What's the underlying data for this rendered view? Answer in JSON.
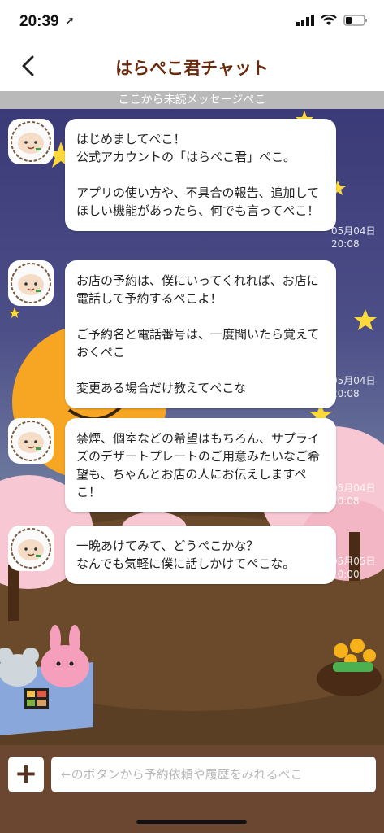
{
  "status_bar": {
    "time": "20:39"
  },
  "nav": {
    "title": "はらぺこ君チャット"
  },
  "unread_divider": "ここから未読メッセージぺこ",
  "messages": [
    {
      "text": "はじめましてぺこ！\n公式アカウントの「はらぺこ君」ぺこ。\n\nアプリの使い方や、不具合の報告、追加してほしい機能があったら、何でも言ってぺこ！",
      "time": "05月04日\n20:08"
    },
    {
      "text": "お店の予約は、僕にいってくれれば、お店に電話して予約するぺこよ！\n\nご予約名と電話番号は、一度聞いたら覚えておくぺこ\n\n変更ある場合だけ教えてぺこな",
      "time": "05月04日\n20:08"
    },
    {
      "text": "禁煙、個室などの希望はもちろん、サプライズのデザートプレートのご用意みたいなご希望も、ちゃんとお店の人にお伝えしますぺこ！",
      "time": "05月04日\n20:08"
    },
    {
      "text": "一晩あけてみて、どうぺこかな？\nなんでも気軽に僕に話しかけてぺこな。",
      "time": "05月05日\n10:00"
    }
  ],
  "input": {
    "placeholder": "←のボタンから予約依頼や履歴をみれるぺこ"
  },
  "colors": {
    "title": "#6a2a0e",
    "input_bar": "#6b4631",
    "sky": "#3b3a78",
    "ground": "#553c22"
  }
}
